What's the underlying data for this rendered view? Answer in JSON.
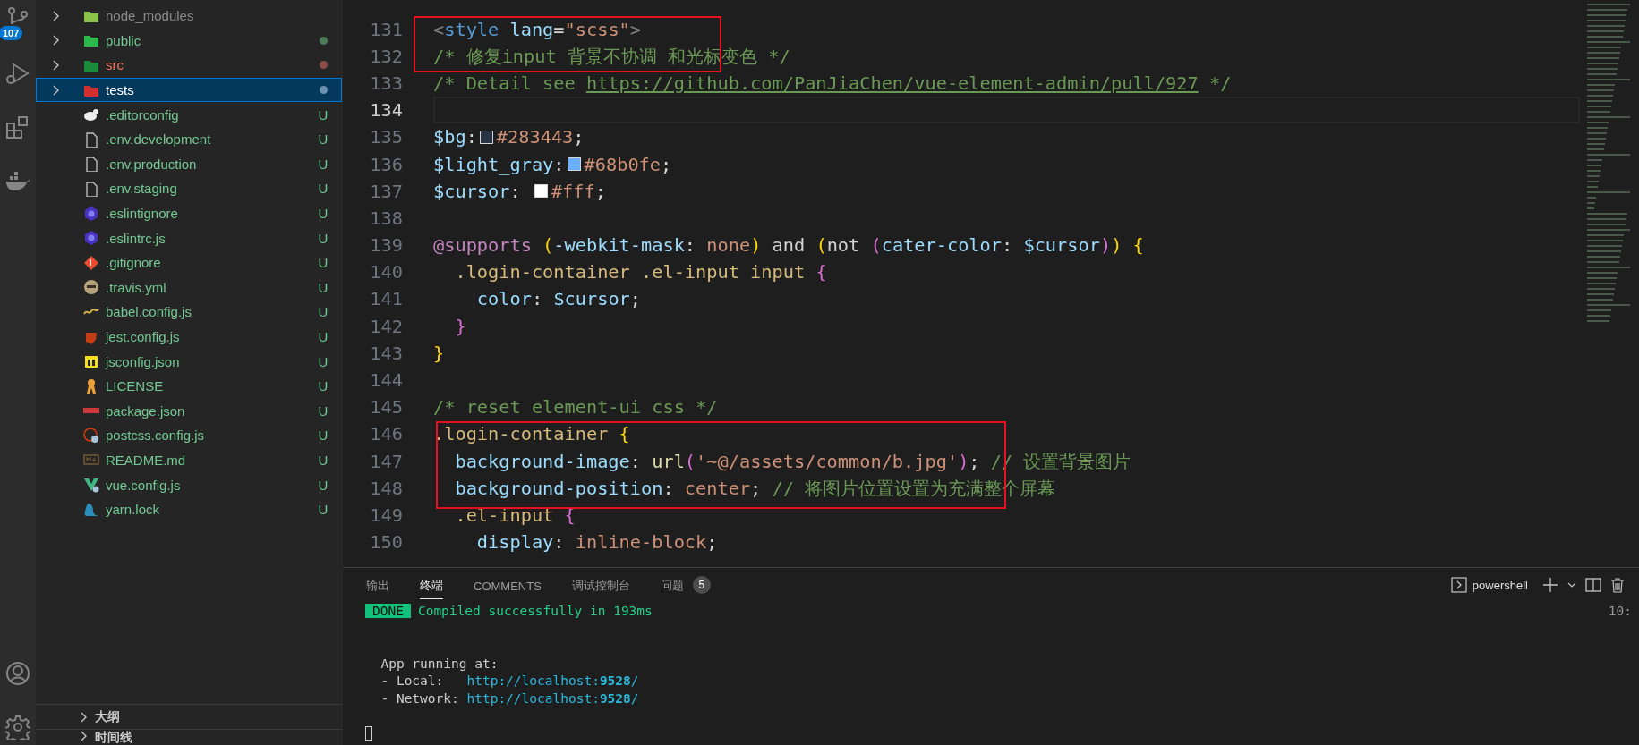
{
  "activity_bar": {
    "source_control_badge": "107"
  },
  "explorer": {
    "items": [
      {
        "name": "node_modules",
        "kind": "folder-node",
        "expanded": false,
        "selected": false,
        "ignored": true,
        "error": false
      },
      {
        "name": "public",
        "kind": "folder-public",
        "expanded": false,
        "selected": false,
        "ignored": false,
        "error": false,
        "color": "#4b7a57"
      },
      {
        "name": "src",
        "kind": "folder-src",
        "expanded": false,
        "selected": false,
        "ignored": false,
        "error": true,
        "color": "#8a4c47"
      },
      {
        "name": "tests",
        "kind": "folder-tests",
        "expanded": false,
        "selected": true,
        "ignored": false,
        "error": false,
        "color": "#6d8fb0"
      },
      {
        "name": ".editorconfig",
        "kind": "editorconfig",
        "selected": false,
        "ignored": false,
        "error": false,
        "badge": "U"
      },
      {
        "name": ".env.development",
        "kind": "file",
        "selected": false,
        "ignored": false,
        "error": false,
        "badge": "U"
      },
      {
        "name": ".env.production",
        "kind": "file",
        "selected": false,
        "ignored": false,
        "error": false,
        "badge": "U"
      },
      {
        "name": ".env.staging",
        "kind": "file",
        "selected": false,
        "ignored": false,
        "error": false,
        "badge": "U"
      },
      {
        "name": ".eslintignore",
        "kind": "eslint",
        "selected": false,
        "ignored": false,
        "error": false,
        "badge": "U"
      },
      {
        "name": ".eslintrc.js",
        "kind": "eslint",
        "selected": false,
        "ignored": false,
        "error": false,
        "badge": "U"
      },
      {
        "name": ".gitignore",
        "kind": "git",
        "selected": false,
        "ignored": false,
        "error": false,
        "badge": "U"
      },
      {
        "name": ".travis.yml",
        "kind": "travis",
        "selected": false,
        "ignored": false,
        "error": false,
        "badge": "U"
      },
      {
        "name": "babel.config.js",
        "kind": "babel",
        "selected": false,
        "ignored": false,
        "error": false,
        "badge": "U"
      },
      {
        "name": "jest.config.js",
        "kind": "jest",
        "selected": false,
        "ignored": false,
        "error": false,
        "badge": "U"
      },
      {
        "name": "jsconfig.json",
        "kind": "js",
        "selected": false,
        "ignored": false,
        "error": false,
        "badge": "U"
      },
      {
        "name": "LICENSE",
        "kind": "license",
        "selected": false,
        "ignored": false,
        "error": false,
        "badge": "U"
      },
      {
        "name": "package.json",
        "kind": "npm",
        "selected": false,
        "ignored": false,
        "error": false,
        "badge": "U"
      },
      {
        "name": "postcss.config.js",
        "kind": "postcss",
        "selected": false,
        "ignored": false,
        "error": false,
        "badge": "U"
      },
      {
        "name": "README.md",
        "kind": "markdown",
        "selected": false,
        "ignored": false,
        "error": false,
        "badge": "U"
      },
      {
        "name": "vue.config.js",
        "kind": "vue",
        "selected": false,
        "ignored": false,
        "error": false,
        "badge": "U"
      },
      {
        "name": "yarn.lock",
        "kind": "yarn",
        "selected": false,
        "ignored": false,
        "error": false,
        "badge": "U"
      }
    ],
    "sections": [
      {
        "title": "大纲",
        "expanded": false
      },
      {
        "title": "时间线",
        "expanded": false
      }
    ]
  },
  "editor": {
    "annotations": [
      {
        "kind": "highlight-box"
      },
      {
        "kind": "highlight-box"
      }
    ],
    "lines": [
      {
        "number": "131",
        "current": false,
        "tokens": [
          {
            "kind": "tag",
            "text": "<"
          },
          {
            "kind": "name",
            "text": "style"
          },
          {
            "kind": "attr",
            "text": " lang"
          },
          {
            "kind": "punct",
            "text": "="
          },
          {
            "kind": "string",
            "text": "\"scss\""
          },
          {
            "kind": "tag",
            "text": ">"
          }
        ]
      },
      {
        "number": "132",
        "current": false,
        "tokens": [
          {
            "kind": "comment",
            "text": "/* 修复input 背景不协调 和光标变色 */"
          }
        ]
      },
      {
        "number": "133",
        "current": false,
        "tokens": [
          {
            "kind": "comment",
            "text": "/* Detail see "
          },
          {
            "kind": "link",
            "text": "https://github.com/PanJiaChen/vue-element-admin/pull/927"
          },
          {
            "kind": "comment",
            "text": " */"
          }
        ]
      },
      {
        "number": "134",
        "current": true
      },
      {
        "number": "135",
        "current": false,
        "tokens": [
          {
            "kind": "var",
            "text": "$bg"
          },
          {
            "kind": "punct",
            "text": ":"
          },
          {
            "kind": "swatch",
            "color": "#283443"
          },
          {
            "kind": "value",
            "text": "#283443"
          },
          {
            "kind": "punct",
            "text": ";"
          }
        ]
      },
      {
        "number": "136",
        "current": false,
        "tokens": [
          {
            "kind": "var",
            "text": "$light_gray"
          },
          {
            "kind": "punct",
            "text": ":"
          },
          {
            "kind": "swatch",
            "color": "#68b0fe"
          },
          {
            "kind": "value",
            "text": "#68b0fe"
          },
          {
            "kind": "punct",
            "text": ";"
          }
        ]
      },
      {
        "number": "137",
        "current": false,
        "tokens": [
          {
            "kind": "var",
            "text": "$cursor"
          },
          {
            "kind": "punct",
            "text": ": "
          },
          {
            "kind": "swatch",
            "color": "#ffffff"
          },
          {
            "kind": "value",
            "text": "#fff"
          },
          {
            "kind": "punct",
            "text": ";"
          }
        ]
      },
      {
        "number": "138",
        "current": false
      },
      {
        "number": "139",
        "current": false,
        "tokens": [
          {
            "kind": "keyword",
            "text": "@supports "
          },
          {
            "kind": "b1",
            "text": "("
          },
          {
            "kind": "var",
            "text": "-webkit-mask"
          },
          {
            "kind": "punct",
            "text": ": "
          },
          {
            "kind": "value",
            "text": "none"
          },
          {
            "kind": "b1",
            "text": ")"
          },
          {
            "kind": "punct",
            "text": " and "
          },
          {
            "kind": "b1",
            "text": "("
          },
          {
            "kind": "punct",
            "text": "not "
          },
          {
            "kind": "b2",
            "text": "("
          },
          {
            "kind": "var",
            "text": "cater-color"
          },
          {
            "kind": "punct",
            "text": ": "
          },
          {
            "kind": "var",
            "text": "$cursor"
          },
          {
            "kind": "b2",
            "text": ")"
          },
          {
            "kind": "b1",
            "text": ")"
          },
          {
            "kind": "b1",
            "text": " {"
          }
        ]
      },
      {
        "number": "140",
        "current": false,
        "tokens": [
          {
            "kind": "selector",
            "text": "  .login-container .el-input input "
          },
          {
            "kind": "b2",
            "text": "{"
          }
        ]
      },
      {
        "number": "141",
        "current": false,
        "tokens": [
          {
            "kind": "prop",
            "text": "    color"
          },
          {
            "kind": "punct",
            "text": ": "
          },
          {
            "kind": "var",
            "text": "$cursor"
          },
          {
            "kind": "punct",
            "text": ";"
          }
        ]
      },
      {
        "number": "142",
        "current": false,
        "tokens": [
          {
            "kind": "b2",
            "text": "  }"
          }
        ]
      },
      {
        "number": "143",
        "current": false,
        "tokens": [
          {
            "kind": "b1",
            "text": "}"
          }
        ]
      },
      {
        "number": "144",
        "current": false
      },
      {
        "number": "145",
        "current": false,
        "tokens": [
          {
            "kind": "comment",
            "text": "/* reset element-ui css */"
          }
        ]
      },
      {
        "number": "146",
        "current": false,
        "tokens": [
          {
            "kind": "selector",
            "text": ".login-container "
          },
          {
            "kind": "b1",
            "text": "{"
          }
        ]
      },
      {
        "number": "147",
        "current": false,
        "tokens": [
          {
            "kind": "prop",
            "text": "  background-image"
          },
          {
            "kind": "punct",
            "text": ": "
          },
          {
            "kind": "fn",
            "text": "url"
          },
          {
            "kind": "b2",
            "text": "("
          },
          {
            "kind": "string",
            "text": "'~@/assets/common/b.jpg'"
          },
          {
            "kind": "b2",
            "text": ")"
          },
          {
            "kind": "punct",
            "text": "; "
          },
          {
            "kind": "comment",
            "text": "// 设置背景图片"
          }
        ]
      },
      {
        "number": "148",
        "current": false,
        "tokens": [
          {
            "kind": "prop",
            "text": "  background-position"
          },
          {
            "kind": "punct",
            "text": ": "
          },
          {
            "kind": "value",
            "text": "center"
          },
          {
            "kind": "punct",
            "text": "; "
          },
          {
            "kind": "comment",
            "text": "// 将图片位置设置为充满整个屏幕"
          }
        ]
      },
      {
        "number": "149",
        "current": false,
        "tokens": [
          {
            "kind": "selector",
            "text": "  .el-input "
          },
          {
            "kind": "b2",
            "text": "{"
          }
        ]
      },
      {
        "number": "150",
        "current": false,
        "tokens": [
          {
            "kind": "prop",
            "text": "    display"
          },
          {
            "kind": "punct",
            "text": ": "
          },
          {
            "kind": "value",
            "text": "inline-block"
          },
          {
            "kind": "punct",
            "text": ";"
          }
        ]
      }
    ]
  },
  "panel": {
    "tabs": [
      {
        "label": "输出",
        "selected": false
      },
      {
        "label": "终端",
        "selected": true
      },
      {
        "label": "COMMENTS",
        "selected": false
      },
      {
        "label": "调试控制台",
        "selected": false
      },
      {
        "label": "问题",
        "selected": false,
        "count": "5"
      }
    ],
    "terminal_name": "powershell",
    "terminal": [
      {
        "kind": "done",
        "badge": "DONE",
        "text": "Compiled successfully in 193ms",
        "time": "10:"
      },
      {
        "kind": "blank"
      },
      {
        "kind": "blank"
      },
      {
        "kind": "text",
        "text": "App running at:"
      },
      {
        "kind": "url",
        "label": "- Local:",
        "url": "http://localhost:**9528**/"
      },
      {
        "kind": "url",
        "label": "- Network:",
        "url": "http://localhost:**9528**/"
      },
      {
        "kind": "blank"
      },
      {
        "kind": "cursor"
      }
    ]
  }
}
